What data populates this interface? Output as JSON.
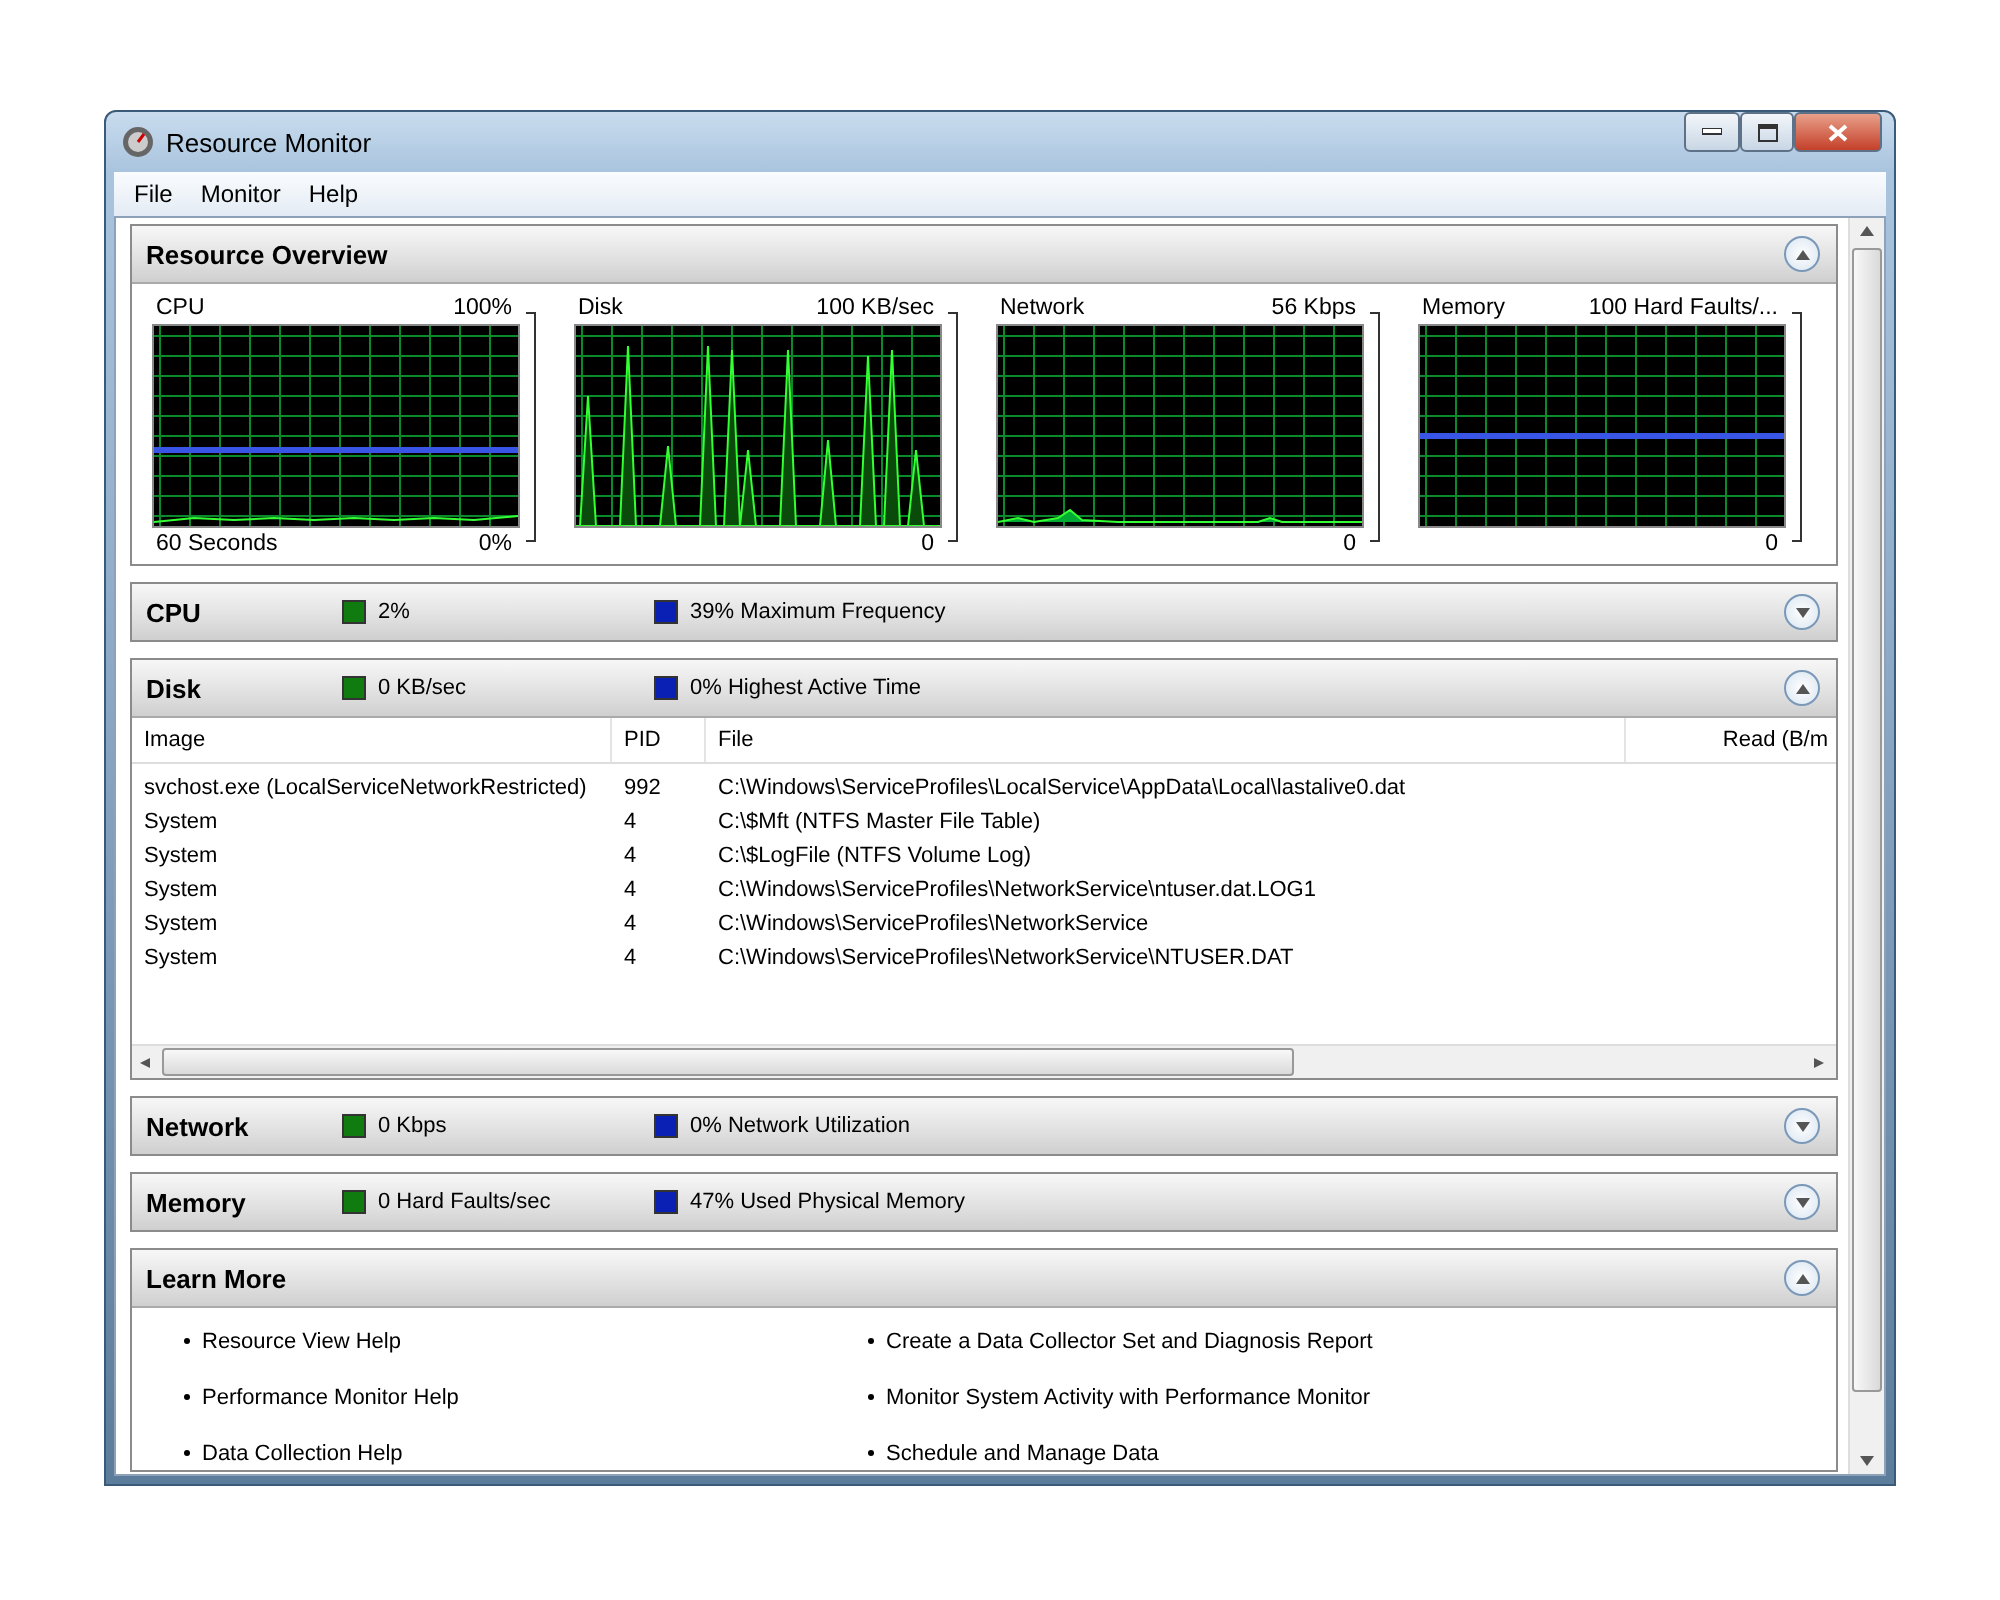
{
  "window": {
    "title": "Resource Monitor"
  },
  "menu": [
    {
      "label": "File"
    },
    {
      "label": "Monitor"
    },
    {
      "label": "Help"
    }
  ],
  "overview": {
    "title": "Resource Overview",
    "expanded": true,
    "graphs": [
      {
        "name": "CPU",
        "max": "100%",
        "min": "0%",
        "time": "60 Seconds",
        "kind": "line-with-trace"
      },
      {
        "name": "Disk",
        "max": "100 KB/sec",
        "min": "0",
        "kind": "spikes"
      },
      {
        "name": "Network",
        "max": "56 Kbps",
        "min": "0",
        "kind": "trace"
      },
      {
        "name": "Memory",
        "max": "100 Hard Faults/...",
        "min": "0",
        "kind": "line"
      }
    ]
  },
  "sections": [
    {
      "title": "CPU",
      "expanded": false,
      "stats": [
        {
          "text": "2%",
          "color": "#107c10"
        },
        {
          "text": "39% Maximum Frequency",
          "color": "#0a1fb4"
        }
      ]
    },
    {
      "title": "Disk",
      "expanded": true,
      "stats": [
        {
          "text": "0 KB/sec",
          "color": "#107c10"
        },
        {
          "text": "0% Highest Active Time",
          "color": "#0a1fb4"
        }
      ],
      "table": {
        "columns": [
          "Image",
          "PID",
          "File",
          "Read (B/m"
        ],
        "rows": [
          [
            "svchost.exe (LocalServiceNetworkRestricted)",
            "992",
            "C:\\Windows\\ServiceProfiles\\LocalService\\AppData\\Local\\lastalive0.dat"
          ],
          [
            "System",
            "4",
            "C:\\$Mft (NTFS Master File Table)"
          ],
          [
            "System",
            "4",
            "C:\\$LogFile (NTFS Volume Log)"
          ],
          [
            "System",
            "4",
            "C:\\Windows\\ServiceProfiles\\NetworkService\\ntuser.dat.LOG1"
          ],
          [
            "System",
            "4",
            "C:\\Windows\\ServiceProfiles\\NetworkService"
          ],
          [
            "System",
            "4",
            "C:\\Windows\\ServiceProfiles\\NetworkService\\NTUSER.DAT"
          ]
        ]
      }
    },
    {
      "title": "Network",
      "expanded": false,
      "stats": [
        {
          "text": "0 Kbps",
          "color": "#107c10"
        },
        {
          "text": "0% Network Utilization",
          "color": "#0a1fb4"
        }
      ]
    },
    {
      "title": "Memory",
      "expanded": false,
      "stats": [
        {
          "text": "0 Hard Faults/sec",
          "color": "#107c10"
        },
        {
          "text": "47% Used Physical Memory",
          "color": "#0a1fb4"
        }
      ]
    }
  ],
  "learn_more": {
    "title": "Learn More",
    "expanded": true,
    "links": [
      "Resource View Help",
      "Create a Data Collector Set and Diagnosis Report",
      "Performance Monitor Help",
      "Monitor System Activity with Performance Monitor",
      "Data Collection Help",
      "Schedule and Manage Data"
    ]
  }
}
